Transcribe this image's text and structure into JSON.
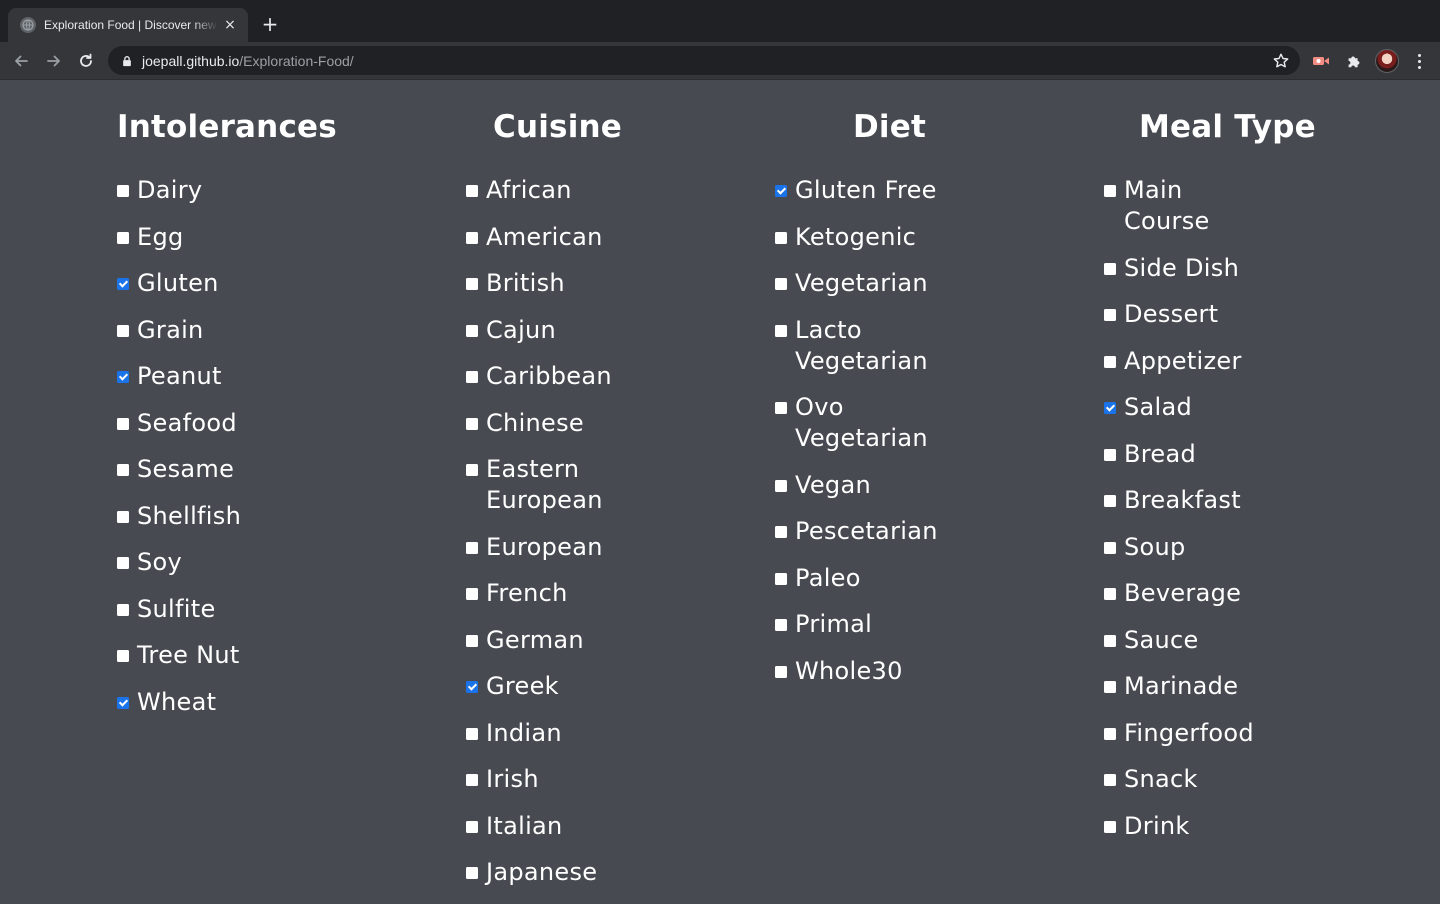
{
  "browser": {
    "tab_title": "Exploration Food | Discover new food",
    "tab_close": "×",
    "new_tab": "+",
    "url_host": "joepall.github.io",
    "url_path": "/Exploration-Food/"
  },
  "columns": [
    {
      "title": "Intolerances",
      "items": [
        {
          "label": "Dairy",
          "checked": false
        },
        {
          "label": "Egg",
          "checked": false
        },
        {
          "label": "Gluten",
          "checked": true
        },
        {
          "label": "Grain",
          "checked": false
        },
        {
          "label": "Peanut",
          "checked": true
        },
        {
          "label": "Seafood",
          "checked": false
        },
        {
          "label": "Sesame",
          "checked": false
        },
        {
          "label": "Shellfish",
          "checked": false
        },
        {
          "label": "Soy",
          "checked": false
        },
        {
          "label": "Sulfite",
          "checked": false
        },
        {
          "label": "Tree Nut",
          "checked": false
        },
        {
          "label": "Wheat",
          "checked": true
        }
      ]
    },
    {
      "title": "Cuisine",
      "items": [
        {
          "label": "African",
          "checked": false
        },
        {
          "label": "American",
          "checked": false
        },
        {
          "label": "British",
          "checked": false
        },
        {
          "label": "Cajun",
          "checked": false
        },
        {
          "label": "Caribbean",
          "checked": false
        },
        {
          "label": "Chinese",
          "checked": false
        },
        {
          "label": "Eastern European",
          "checked": false
        },
        {
          "label": "European",
          "checked": false
        },
        {
          "label": "French",
          "checked": false
        },
        {
          "label": "German",
          "checked": false
        },
        {
          "label": "Greek",
          "checked": true
        },
        {
          "label": "Indian",
          "checked": false
        },
        {
          "label": "Irish",
          "checked": false
        },
        {
          "label": "Italian",
          "checked": false
        },
        {
          "label": "Japanese",
          "checked": false
        }
      ]
    },
    {
      "title": "Diet",
      "items": [
        {
          "label": "Gluten Free",
          "checked": true
        },
        {
          "label": "Ketogenic",
          "checked": false
        },
        {
          "label": "Vegetarian",
          "checked": false
        },
        {
          "label": "Lacto Vegetarian",
          "checked": false
        },
        {
          "label": "Ovo Vegetarian",
          "checked": false
        },
        {
          "label": "Vegan",
          "checked": false
        },
        {
          "label": "Pescetarian",
          "checked": false
        },
        {
          "label": "Paleo",
          "checked": false
        },
        {
          "label": "Primal",
          "checked": false
        },
        {
          "label": "Whole30",
          "checked": false
        }
      ]
    },
    {
      "title": "Meal Type",
      "items": [
        {
          "label": "Main Course",
          "checked": false
        },
        {
          "label": "Side Dish",
          "checked": false
        },
        {
          "label": "Dessert",
          "checked": false
        },
        {
          "label": "Appetizer",
          "checked": false
        },
        {
          "label": "Salad",
          "checked": true
        },
        {
          "label": "Bread",
          "checked": false
        },
        {
          "label": "Breakfast",
          "checked": false
        },
        {
          "label": "Soup",
          "checked": false
        },
        {
          "label": "Beverage",
          "checked": false
        },
        {
          "label": "Sauce",
          "checked": false
        },
        {
          "label": "Marinade",
          "checked": false
        },
        {
          "label": "Fingerfood",
          "checked": false
        },
        {
          "label": "Snack",
          "checked": false
        },
        {
          "label": "Drink",
          "checked": false
        }
      ]
    }
  ]
}
